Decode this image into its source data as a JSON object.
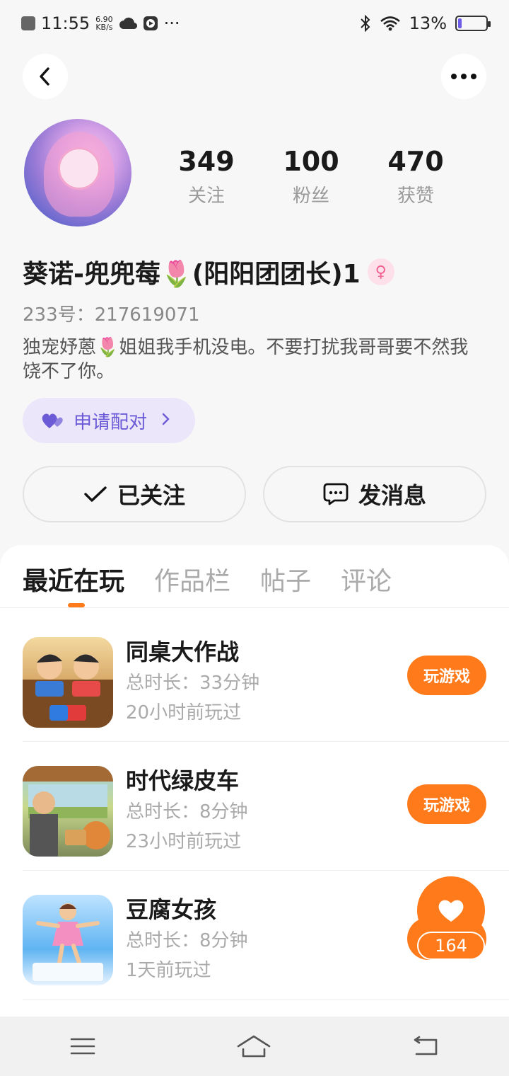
{
  "status_bar": {
    "time": "11:55",
    "net_speed_value": "6.90",
    "net_speed_unit": "KB/s",
    "more": "···",
    "battery": "13%",
    "battery_level": 0.13
  },
  "profile": {
    "stats": [
      {
        "value": "349",
        "label": "关注"
      },
      {
        "value": "100",
        "label": "粉丝"
      },
      {
        "value": "470",
        "label": "获赞"
      }
    ],
    "name": "葵诺-兜兜莓🌷(阳阳团团长)1",
    "gender_symbol": "♀",
    "id_line": "233号：217619071",
    "bio": "独宠妤蒽🌷姐姐我手机没电。不要打扰我哥哥要不然我饶不了你。",
    "pair_button": "申请配对"
  },
  "actions": {
    "follow": "已关注",
    "message": "发消息"
  },
  "tabs": [
    "最近在玩",
    "作品栏",
    "帖子",
    "评论"
  ],
  "games": [
    {
      "title": "同桌大作战",
      "duration": "总时长：33分钟",
      "last_played": "20小时前玩过",
      "button": "玩游戏"
    },
    {
      "title": "时代绿皮车",
      "duration": "总时长：8分钟",
      "last_played": "23小时前玩过",
      "button": "玩游戏"
    },
    {
      "title": "豆腐女孩",
      "duration": "总时长：8分钟",
      "last_played": "1天前玩过"
    }
  ],
  "like_fab": {
    "count": "164"
  },
  "colors": {
    "accent": "#ff7a1a",
    "pair_bg": "#ece6fb",
    "pair_text": "#6b5bd6"
  }
}
